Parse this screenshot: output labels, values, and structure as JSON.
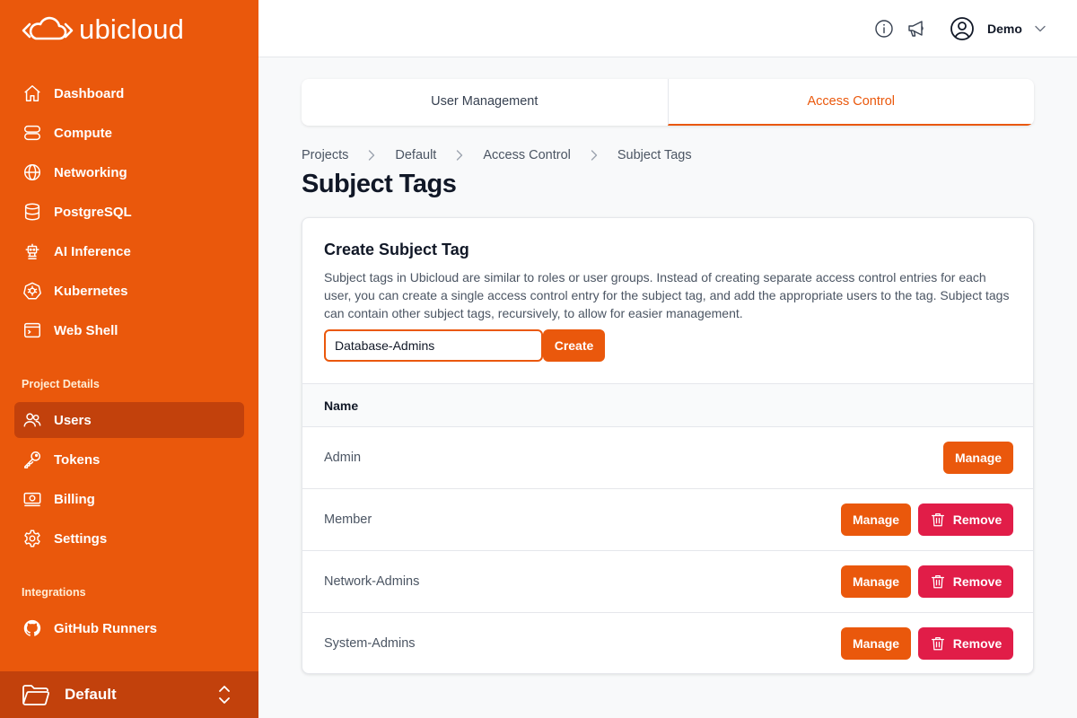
{
  "app": {
    "name": "ubicloud"
  },
  "colors": {
    "brand": "#ea580c",
    "brand_dark": "#c2410c",
    "danger": "#e11d48"
  },
  "sidebar": {
    "main_items": [
      {
        "label": "Dashboard",
        "icon": "home-icon"
      },
      {
        "label": "Compute",
        "icon": "server-icon"
      },
      {
        "label": "Networking",
        "icon": "globe-icon"
      },
      {
        "label": "PostgreSQL",
        "icon": "database-icon"
      },
      {
        "label": "AI Inference",
        "icon": "robot-icon"
      },
      {
        "label": "Kubernetes",
        "icon": "kubernetes-icon"
      },
      {
        "label": "Web Shell",
        "icon": "terminal-icon"
      }
    ],
    "project_section_title": "Project Details",
    "project_items": [
      {
        "label": "Users",
        "icon": "users-icon",
        "active": true
      },
      {
        "label": "Tokens",
        "icon": "key-icon"
      },
      {
        "label": "Billing",
        "icon": "banknote-icon"
      },
      {
        "label": "Settings",
        "icon": "gear-icon"
      }
    ],
    "integrations_section_title": "Integrations",
    "integration_items": [
      {
        "label": "GitHub Runners",
        "icon": "github-icon"
      }
    ],
    "project_switcher": {
      "label": "Default",
      "icon": "folder-icon"
    }
  },
  "topbar": {
    "user": {
      "name": "Demo"
    }
  },
  "tabs": [
    {
      "label": "User Management",
      "active": false
    },
    {
      "label": "Access Control",
      "active": true
    }
  ],
  "breadcrumb": [
    "Projects",
    "Default",
    "Access Control",
    "Subject Tags"
  ],
  "page": {
    "title": "Subject Tags"
  },
  "create_form": {
    "title": "Create Subject Tag",
    "description": "Subject tags in Ubicloud are similar to roles or user groups. Instead of creating separate access control entries for each user, you can create a single access control entry for the subject tag, and add the appropriate users to the tag. Subject tags can contain other subject tags, recursively, to allow for easier management.",
    "input_value": "Database-Admins",
    "button_label": "Create"
  },
  "table": {
    "header": "Name",
    "rows": [
      {
        "name": "Admin",
        "manage": "Manage",
        "remove": null
      },
      {
        "name": "Member",
        "manage": "Manage",
        "remove": "Remove"
      },
      {
        "name": "Network-Admins",
        "manage": "Manage",
        "remove": "Remove"
      },
      {
        "name": "System-Admins",
        "manage": "Manage",
        "remove": "Remove"
      }
    ]
  }
}
